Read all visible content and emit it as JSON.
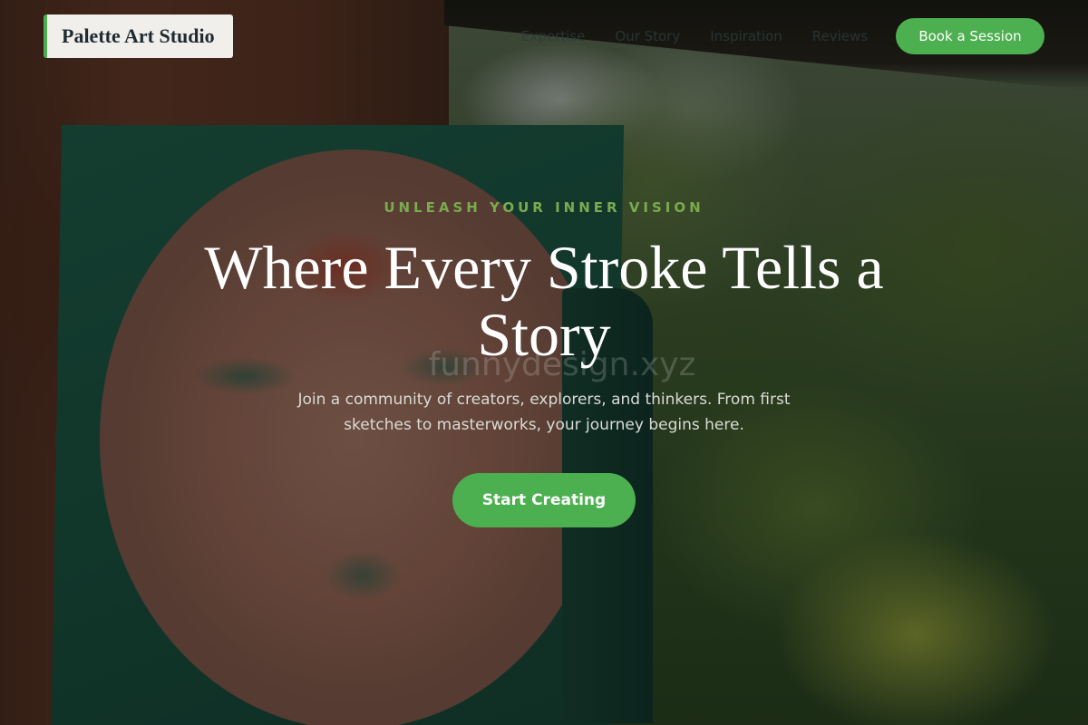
{
  "brand": {
    "name": "Palette Art Studio"
  },
  "nav": {
    "links": [
      "Expertise",
      "Our Story",
      "Inspiration",
      "Reviews"
    ],
    "cta_label": "Book a Session"
  },
  "hero": {
    "eyebrow": "UNLEASH YOUR INNER VISION",
    "headline": "Where Every Stroke Tells a Story",
    "watermark": "funnydesign.xyz",
    "subtext": "Join a community of creators, explorers, and thinkers. From first sketches to masterworks, your journey begins here.",
    "cta_label": "Start Creating"
  },
  "colors": {
    "accent": "#4caf50",
    "eyebrow": "#7aab4e",
    "brand_bg": "#f1efeb"
  }
}
